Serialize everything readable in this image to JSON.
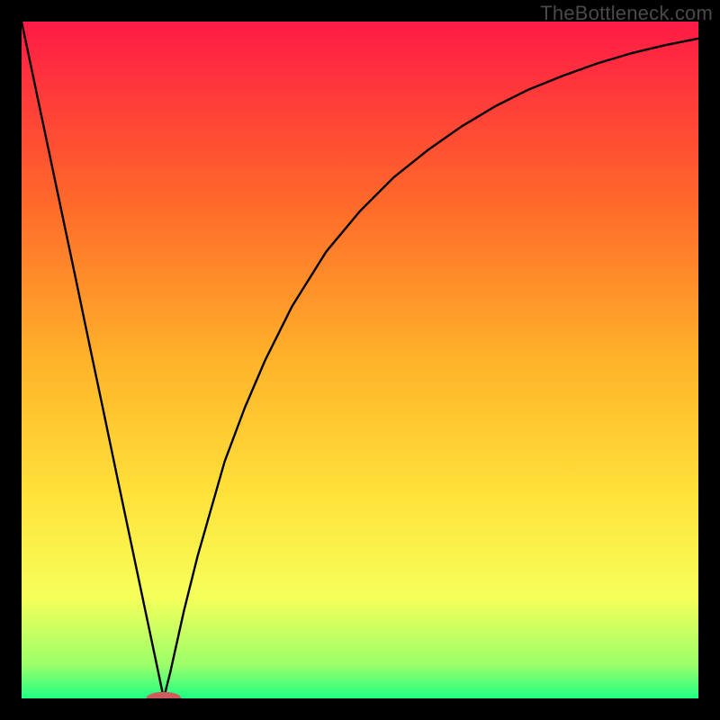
{
  "watermark": "TheBottleneck.com",
  "colors": {
    "frame": "#000000",
    "gradient_top": "#ff1a45",
    "gradient_mid1": "#ff6a2a",
    "gradient_mid2": "#ffb32a",
    "gradient_mid3": "#ffe23a",
    "gradient_mid4": "#f6ff5a",
    "gradient_bottom1": "#9cff6a",
    "gradient_bottom2": "#1eff84",
    "curve": "#000000",
    "marker_fill": "#cd5c5c",
    "marker_stroke": "#cd5c5c"
  },
  "chart_data": {
    "type": "line",
    "title": "",
    "xlabel": "",
    "ylabel": "",
    "xlim": [
      0,
      100
    ],
    "ylim": [
      0,
      100
    ],
    "series": [
      {
        "name": "bottleneck-curve-left",
        "x": [
          0,
          2,
          4,
          6,
          8,
          10,
          12,
          14,
          16,
          18,
          20,
          21
        ],
        "values": [
          100,
          90.5,
          81,
          71.5,
          62,
          52.4,
          42.9,
          33.3,
          23.8,
          14.3,
          4.8,
          0
        ]
      },
      {
        "name": "bottleneck-curve-right",
        "x": [
          21,
          22,
          24,
          26,
          28,
          30,
          33,
          36,
          40,
          45,
          50,
          55,
          60,
          65,
          70,
          75,
          80,
          85,
          90,
          95,
          100
        ],
        "values": [
          0,
          4,
          13,
          21,
          28,
          35,
          43,
          50,
          58,
          66,
          72,
          77,
          81,
          84.5,
          87.5,
          90,
          92,
          93.8,
          95.3,
          96.5,
          97.5
        ]
      }
    ],
    "marker": {
      "x": 21,
      "y": 0,
      "rx": 2.5,
      "ry": 0.9
    },
    "gradient_stops": [
      {
        "offset": 0.0,
        "key": "gradient_top"
      },
      {
        "offset": 0.27,
        "key": "gradient_mid1"
      },
      {
        "offset": 0.5,
        "key": "gradient_mid2"
      },
      {
        "offset": 0.7,
        "key": "gradient_mid3"
      },
      {
        "offset": 0.85,
        "key": "gradient_mid4"
      },
      {
        "offset": 0.95,
        "key": "gradient_bottom1"
      },
      {
        "offset": 1.0,
        "key": "gradient_bottom2"
      }
    ]
  }
}
